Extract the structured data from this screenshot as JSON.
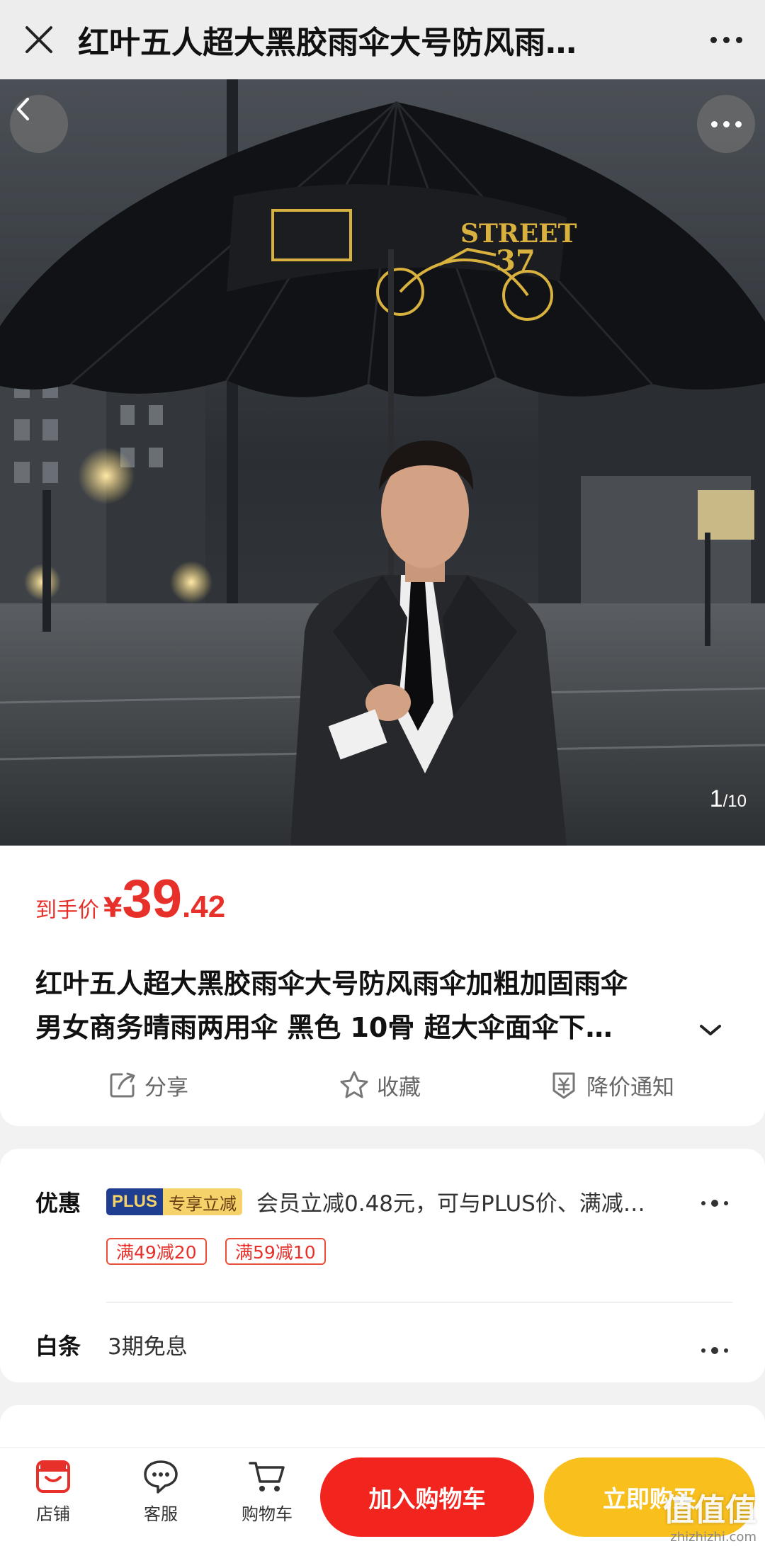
{
  "header": {
    "title": "红叶五人超大黑胶雨伞大号防风雨…"
  },
  "gallery": {
    "current": "1",
    "total": "/10"
  },
  "price": {
    "label": "到手价",
    "currency": "¥",
    "integer": "39",
    "decimal": ".42"
  },
  "product": {
    "title_line1": "红叶五人超大黑胶雨伞大号防风雨伞加粗加固雨伞",
    "title_line2": "男女商务晴雨两用伞 黑色 10骨 超大伞面伞下…"
  },
  "actions": {
    "share": "分享",
    "favorite": "收藏",
    "price_alert": "降价通知"
  },
  "promotion": {
    "label": "优惠",
    "plus_tag": "PLUS",
    "plus_sub": "专享立减",
    "description": "会员立减0.48元，可与PLUS价、满减…",
    "coupons": [
      "满49减20",
      "满59减10"
    ]
  },
  "baitiao": {
    "label": "白条",
    "description": "3期免息"
  },
  "bottom_nav": {
    "shop": "店铺",
    "service": "客服",
    "cart": "购物车",
    "add_to_cart": "加入购物车",
    "buy_now": "立即购买"
  },
  "watermark": {
    "text": "值值值",
    "url": "zhizhizhi.com"
  },
  "colors": {
    "accent_red": "#e8302a",
    "cart_button": "#f1241e",
    "buy_button": "#f8bf1d",
    "plus_navy": "#1f3e8f",
    "plus_gold": "#f6d36a"
  }
}
